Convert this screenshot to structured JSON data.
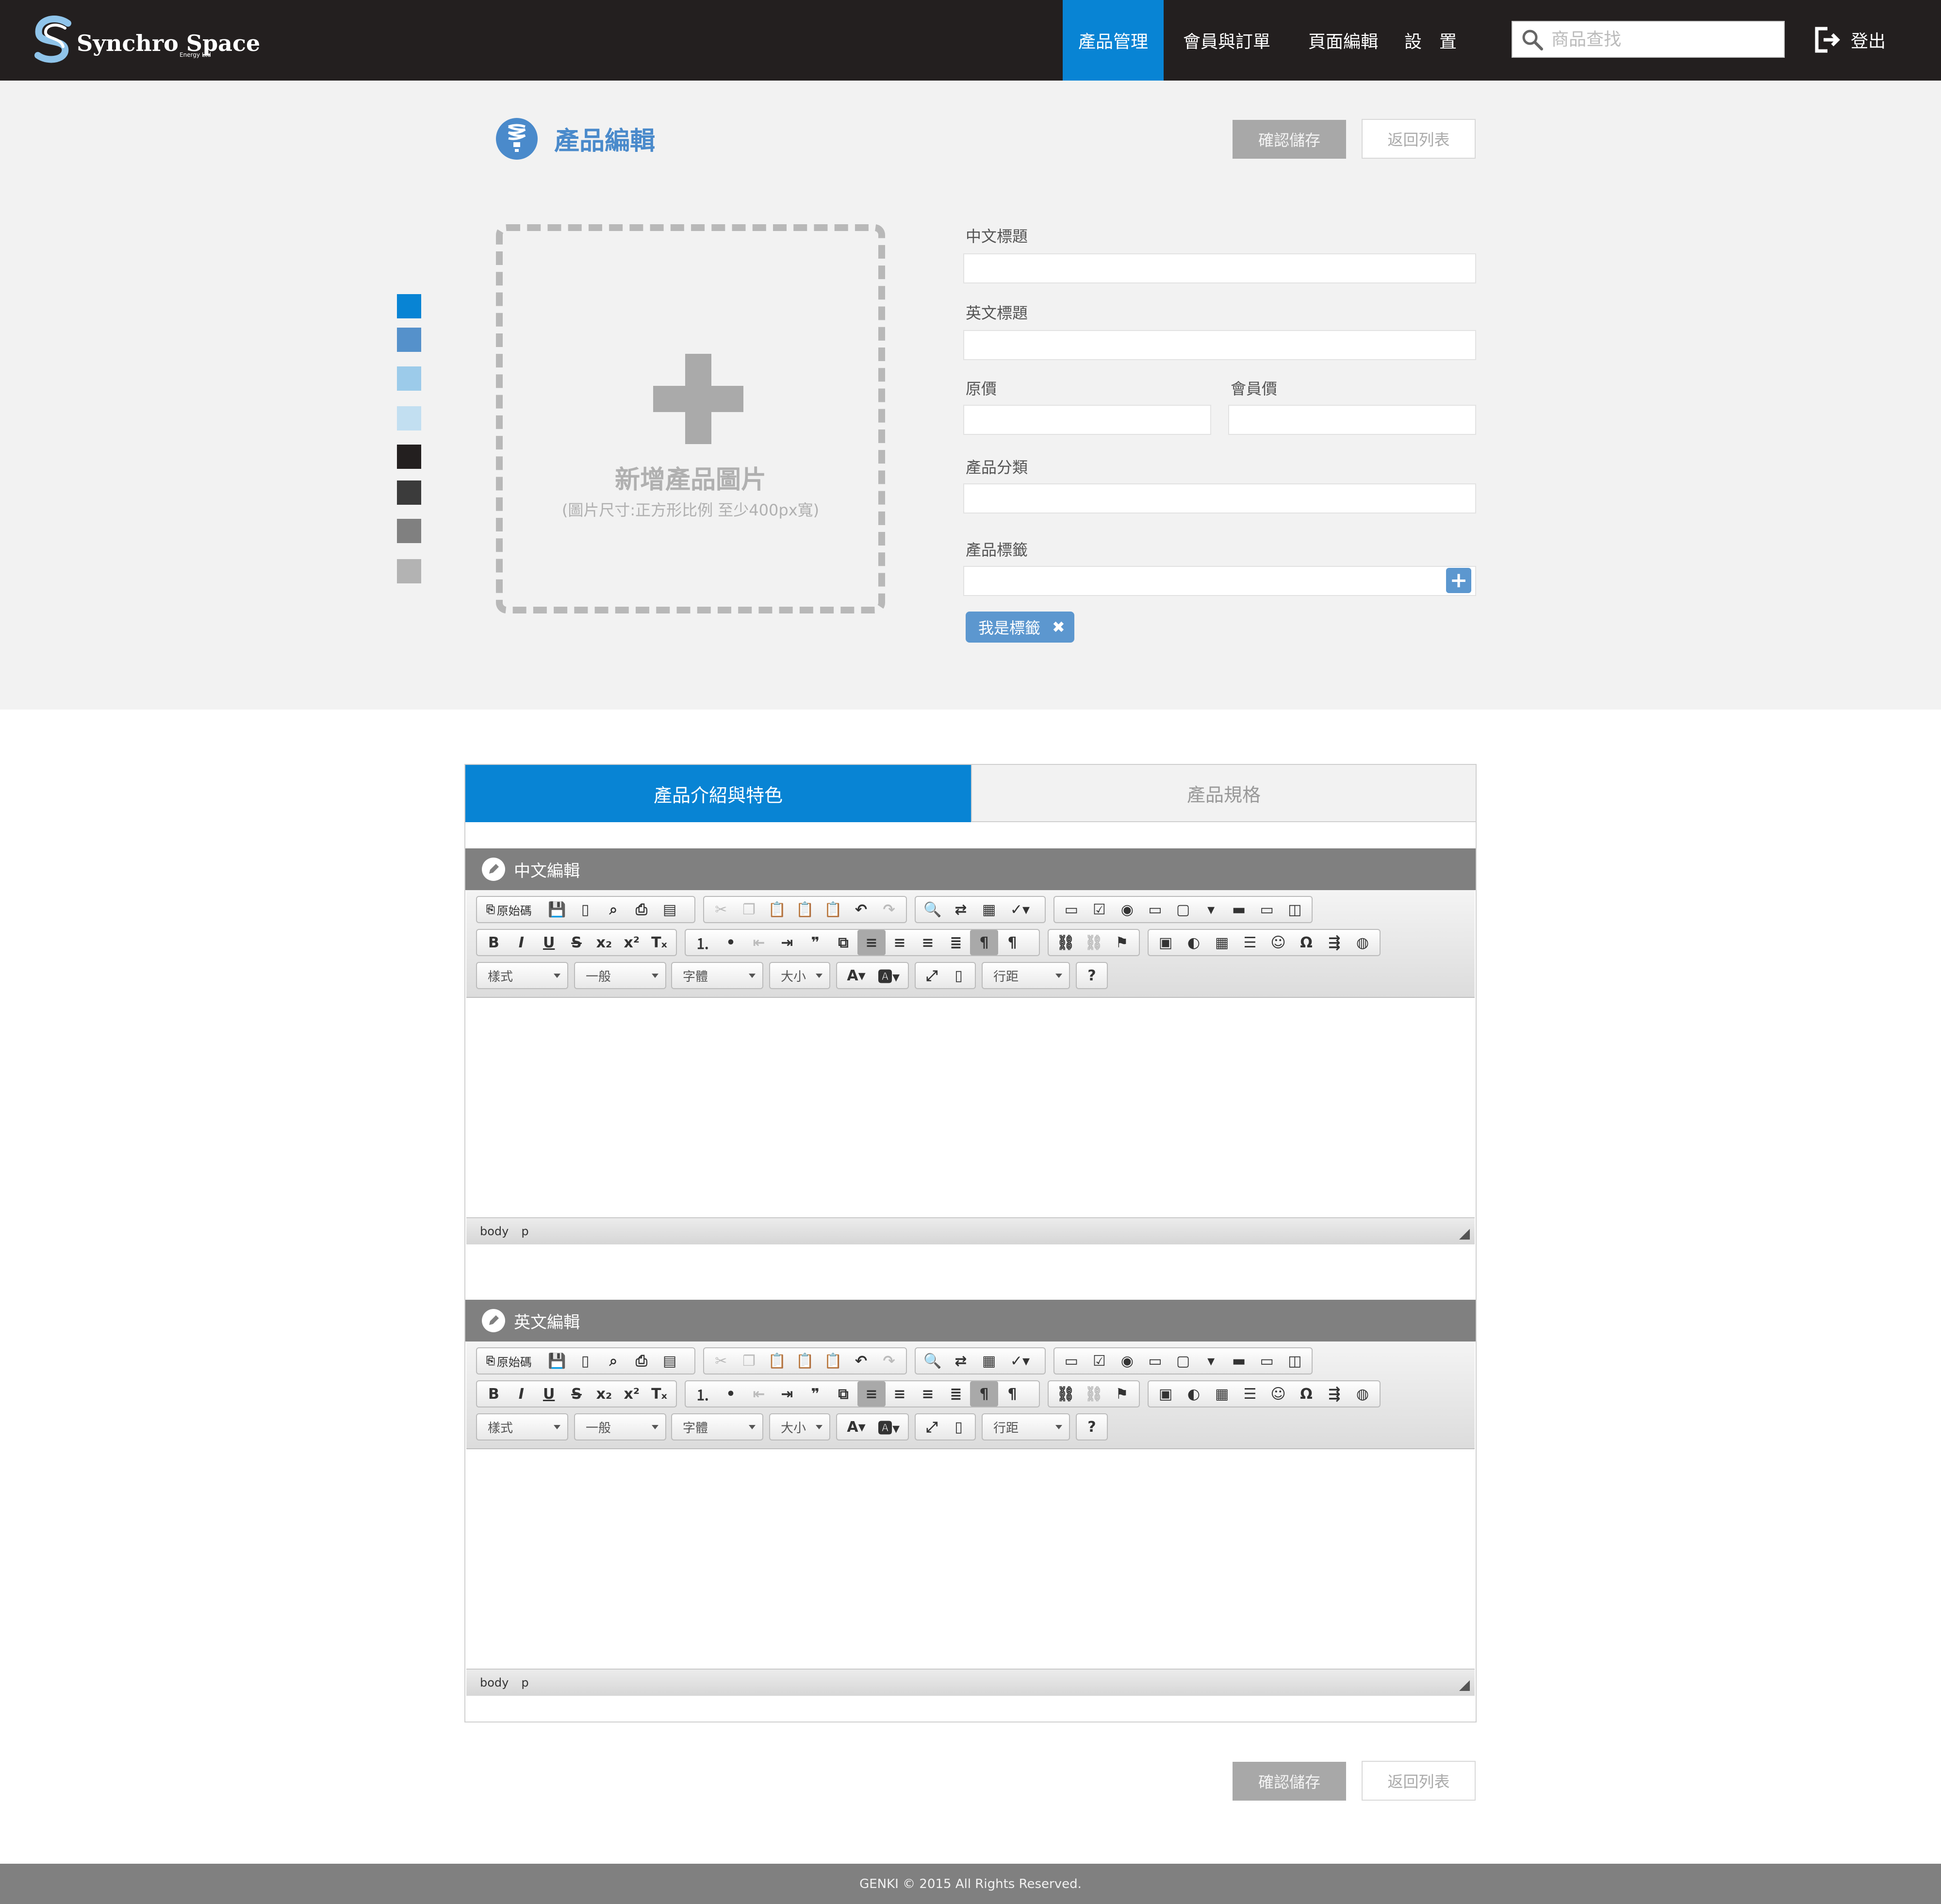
{
  "brand": {
    "name": "Synchro Space",
    "sub": "Energy Ltd"
  },
  "nav": {
    "products": "產品管理",
    "members": "會員與訂單",
    "pages": "頁面編輯",
    "settings": "設　置"
  },
  "search": {
    "placeholder": "商品查找"
  },
  "logout": "登出",
  "page": {
    "title": "產品編輯",
    "save_label": "確認儲存",
    "back_label": "返回列表"
  },
  "colors": {
    "accent": "#0884d4",
    "header": "#231f1f",
    "title": "#4a8acb",
    "tag": "#5c97cf"
  },
  "swatches": [
    "#0884d4",
    "#5591cb",
    "#9ccbea",
    "#c2dff1",
    "#231f1f",
    "#3b3b3b",
    "#808080",
    "#b3b3b3"
  ],
  "upload": {
    "title": "新增產品圖片",
    "hint": "(圖片尺寸:正方形比例 至少400px寬)"
  },
  "form": {
    "zh_title_label": "中文標題",
    "en_title_label": "英文標題",
    "orig_price_label": "原價",
    "member_price_label": "會員價",
    "category_label": "產品分類",
    "tags_label": "產品標籤",
    "tag_chip": "我是標籤"
  },
  "tabs": {
    "intro": "產品介紹與特色",
    "spec": "產品規格"
  },
  "editors": {
    "zh_header": "中文編輯",
    "en_header": "英文編輯",
    "source_label": "原始碼",
    "style_label": "樣式",
    "format_label": "一般",
    "font_label": "字體",
    "size_label": "大小",
    "line_height_label": "行距",
    "help_label": "?",
    "status_body": "body",
    "status_p": "p"
  },
  "footer": "GENKI © 2015  All Rights Reserved."
}
